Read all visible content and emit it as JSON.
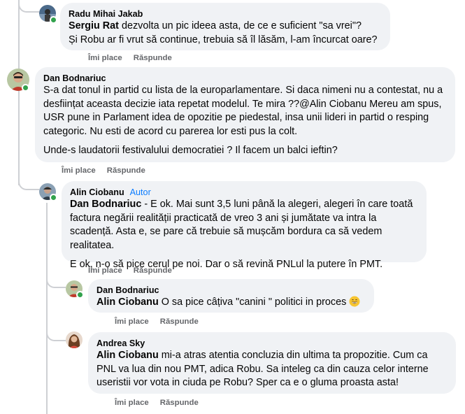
{
  "actions": {
    "like": "Îmi place",
    "reply": "Răspunde"
  },
  "comments": [
    {
      "author": "Radu Mihai Jakab",
      "mention": "Sergiu Rat",
      "lines": [
        "dezvolta un pic ideea asta, de ce e suficient \"sa vrei\"?",
        "Și Robu ar fi vrut să continue, trebuia să îl lăsăm, l-am încurcat oare?"
      ]
    },
    {
      "author": "Dan Bodnariuc",
      "paragraphs": [
        "S-a dat tonul in partid cu lista de la europarlamentare. Si daca nimeni nu a contestat, nu a desființat aceasta decizie iata repetat modelul. Te mira ??@Alin Ciobanu Mereu am spus, USR pune in Parlament idea de opozitie pe piedestal, insa unii lideri in partid o resping categoric. Nu esti de acord cu parerea lor esti pus la colt.",
        "Unde-s laudatorii festivalului democratiei ? Il facem un balci ieftin?"
      ]
    },
    {
      "author": "Alin Ciobanu",
      "badge": "Autor",
      "mention": "Dan Bodnariuc",
      "text1": "- E ok. Mai sunt 3,5 luni până la alegeri, alegeri în care toată factura negării realității practicată de vreo 3 ani și jumătate va intra la scadență. Asta e, se pare că trebuie să mușcăm bordura ca să vedem realitatea.",
      "text2": "E ok, n-o să pice cerul pe noi. Dar o să revină PNLul la putere în PMT."
    },
    {
      "author": "Dan Bodnariuc",
      "mention": "Alin Ciobanu",
      "text": "O sa pice câțiva \"canini \" politici in proces",
      "emoji": "grinning-face-emoji"
    },
    {
      "author": "Andrea Sky",
      "mention": "Alin Ciobanu",
      "text": "mi-a atras atentia concluzia din ultima ta propozitie. Cum ca PNL va lua din nou PMT, adica Robu. Sa inteleg ca din cauza celor interne useristii vor vota in ciuda pe Robu? Sper ca e o gluma proasta asta!"
    }
  ]
}
